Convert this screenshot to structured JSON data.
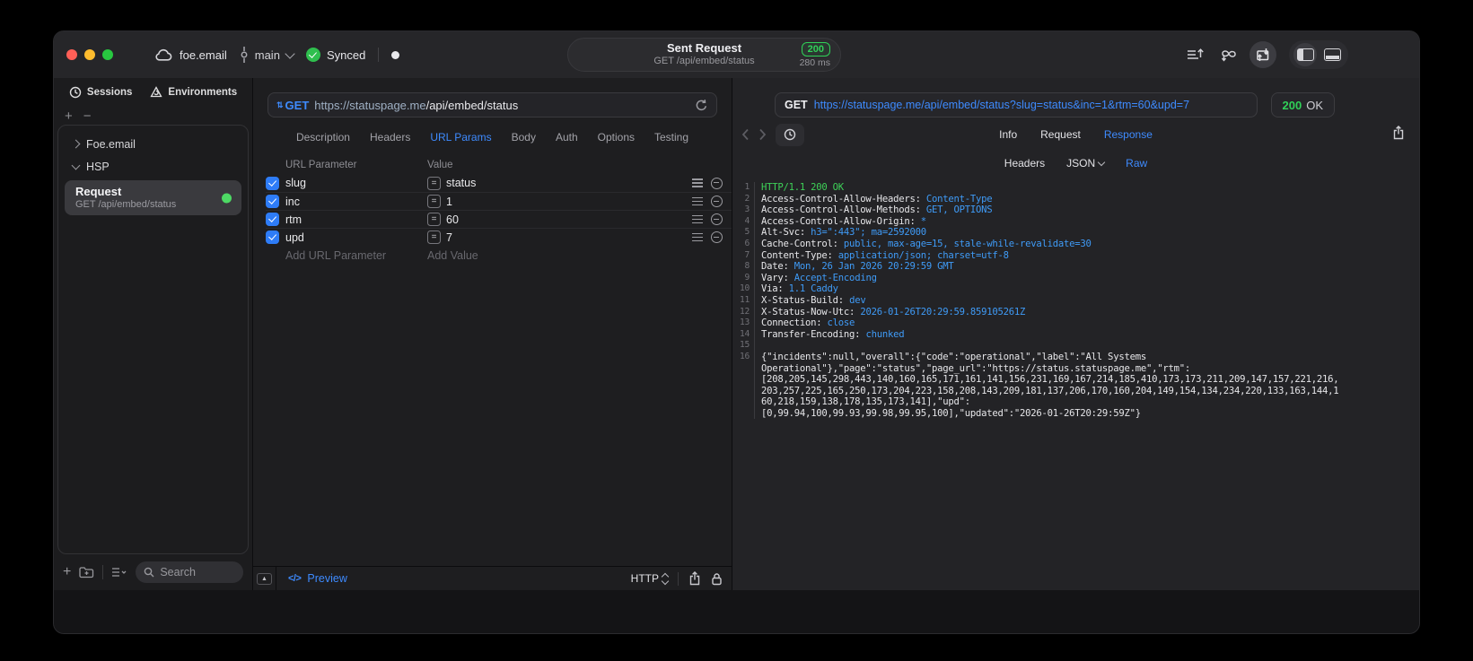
{
  "colors": {
    "accent_blue": "#3E8BFF",
    "success_green": "#30D158",
    "error_red": "#FF5F57"
  },
  "titlebar": {
    "workspace": "foe.email",
    "branch": "main",
    "sync_label": "Synced",
    "request_title": "Sent Request",
    "request_subtitle": "GET /api/embed/status",
    "status_code": "200",
    "response_time": "280 ms"
  },
  "sidebar": {
    "tabs": [
      {
        "label": "Sessions",
        "icon": "clock-icon"
      },
      {
        "label": "Environments",
        "icon": "environments-icon"
      }
    ],
    "tree": [
      {
        "label": "Foe.email",
        "state": "collapsed"
      },
      {
        "label": "HSP",
        "state": "expanded"
      }
    ],
    "request_item": {
      "title": "Request",
      "subtitle": "GET /api/embed/status",
      "status_dot": "green"
    },
    "search_placeholder": "Search"
  },
  "request_panel": {
    "method": "GET",
    "url_host": "https://statuspage.me",
    "url_path": "/api/embed/status",
    "tabs": [
      "Description",
      "Headers",
      "URL Params",
      "Body",
      "Auth",
      "Options",
      "Testing"
    ],
    "active_tab": "URL Params",
    "params_table": {
      "columns": [
        "URL Parameter",
        "Value"
      ],
      "rows": [
        {
          "name": "slug",
          "value": "status",
          "enabled": true
        },
        {
          "name": "inc",
          "value": "1",
          "enabled": true
        },
        {
          "name": "rtm",
          "value": "60",
          "enabled": true
        },
        {
          "name": "upd",
          "value": "7",
          "enabled": true
        }
      ],
      "add_name_placeholder": "Add URL Parameter",
      "add_value_placeholder": "Add Value"
    },
    "footer": {
      "code_glyph": "</>",
      "preview_label": "Preview",
      "protocol": "HTTP"
    }
  },
  "response_panel": {
    "method": "GET",
    "url": "https://statuspage.me/api/embed/status?slug=status&inc=1&rtm=60&upd=7",
    "status_code": "200",
    "status_text": "OK",
    "tabs": [
      "Info",
      "Request",
      "Response"
    ],
    "active_tab": "Response",
    "subtabs": [
      "Headers",
      "JSON",
      "Raw"
    ],
    "active_subtab": "Raw",
    "body_view": {
      "status_line": "HTTP/1.1 200 OK",
      "headers": [
        {
          "name": "Access-Control-Allow-Headers",
          "value": "Content-Type"
        },
        {
          "name": "Access-Control-Allow-Methods",
          "value": "GET, OPTIONS"
        },
        {
          "name": "Access-Control-Allow-Origin",
          "value": "*"
        },
        {
          "name": "Alt-Svc",
          "value": "h3=\":443\"; ma=2592000"
        },
        {
          "name": "Cache-Control",
          "value": "public, max-age=15, stale-while-revalidate=30"
        },
        {
          "name": "Content-Type",
          "value": "application/json; charset=utf-8"
        },
        {
          "name": "Date",
          "value": "Mon, 26 Jan 2026 20:29:59 GMT"
        },
        {
          "name": "Vary",
          "value": "Accept-Encoding"
        },
        {
          "name": "Via",
          "value": "1.1 Caddy"
        },
        {
          "name": "X-Status-Build",
          "value": "dev"
        },
        {
          "name": "X-Status-Now-Utc",
          "value": "2026-01-26T20:29:59.859105261Z"
        },
        {
          "name": "Connection",
          "value": "close"
        },
        {
          "name": "Transfer-Encoding",
          "value": "chunked"
        }
      ],
      "body_start_line_number": 16,
      "body_lines": [
        "{\"incidents\":null,\"overall\":{\"code\":\"operational\",\"label\":\"All Systems",
        "Operational\"},\"page\":\"status\",\"page_url\":\"https://status.statuspage.me\",\"rtm\":",
        "[208,205,145,298,443,140,160,165,171,161,141,156,231,169,167,214,185,410,173,173,211,209,147,157,221,216,",
        "203,257,225,165,250,173,204,223,158,208,143,209,181,137,206,170,160,204,149,154,134,234,220,133,163,144,1",
        "60,218,159,138,178,135,173,141],\"upd\":",
        "[0,99.94,100,99.93,99.98,99.95,100],\"updated\":\"2026-01-26T20:29:59Z\"}"
      ]
    }
  }
}
